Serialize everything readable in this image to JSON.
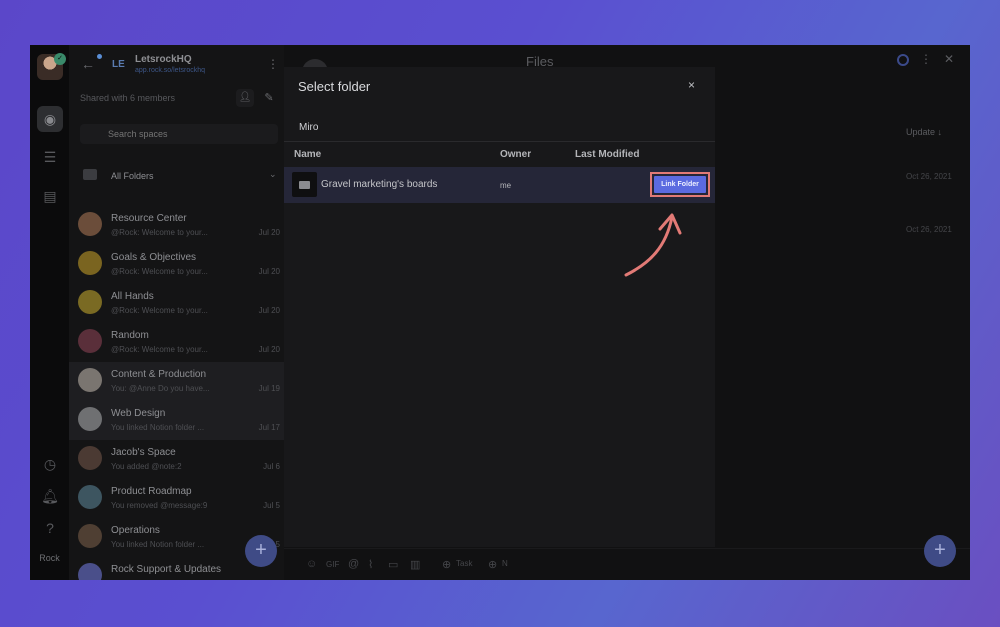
{
  "workspace": {
    "name": "LetsrockHQ",
    "subtitle": "app.rock.so/letsrockhq",
    "logo": "LE",
    "shared": "Shared with 6 members",
    "search_placeholder": "Search spaces",
    "folders_label": "All Folders"
  },
  "rail": {
    "user": "Rock"
  },
  "channels": [
    {
      "name": "Resource Center",
      "preview": "@Rock: Welcome to your...",
      "date": "Jul 20",
      "color": "#6b4d3a"
    },
    {
      "name": "Goals & Objectives",
      "preview": "@Rock: Welcome to your...",
      "date": "Jul 20",
      "color": "#7a6420"
    },
    {
      "name": "All Hands",
      "preview": "@Rock: Welcome to your...",
      "date": "Jul 20",
      "color": "#7a6a23"
    },
    {
      "name": "Random",
      "preview": "@Rock: Welcome to your...",
      "date": "Jul 20",
      "color": "#5a2f3a"
    },
    {
      "name": "Content & Production",
      "preview": "You: @Anne Do you have...",
      "date": "Jul 19",
      "color": "#7a7570"
    },
    {
      "name": "Web Design",
      "preview": "You linked Notion folder ...",
      "date": "Jul 17",
      "color": "#6f7072"
    },
    {
      "name": "Jacob's Space",
      "preview": "You added @note:2",
      "date": "Jul 6",
      "color": "#4b3a33"
    },
    {
      "name": "Product Roadmap",
      "preview": "You removed @message:9",
      "date": "Jul 5",
      "color": "#3d5560"
    },
    {
      "name": "Operations",
      "preview": "You linked Notion folder ...",
      "date": "Jul 5",
      "color": "#4f3f33"
    },
    {
      "name": "Rock Support & Updates",
      "preview": "",
      "date": "",
      "color": "#4a4f8a"
    }
  ],
  "main": {
    "title": "Files",
    "sort_label": "Update ↓",
    "dates": [
      "Oct 26, 2021",
      "Oct 26, 2021"
    ],
    "composer": {
      "task": "Task",
      "note": "N"
    }
  },
  "modal": {
    "title": "Select folder",
    "close": "×",
    "breadcrumb": "Miro",
    "columns": [
      "Name",
      "Owner",
      "Last Modified"
    ],
    "rows": [
      {
        "name": "Gravel marketing's boards",
        "owner": "me",
        "action": "Link Folder"
      }
    ]
  },
  "colors": {
    "accent": "#5b6ae0",
    "highlight": "#e27a76",
    "background_gradient": [
      "#5b47c9",
      "#6a4fc1"
    ]
  }
}
